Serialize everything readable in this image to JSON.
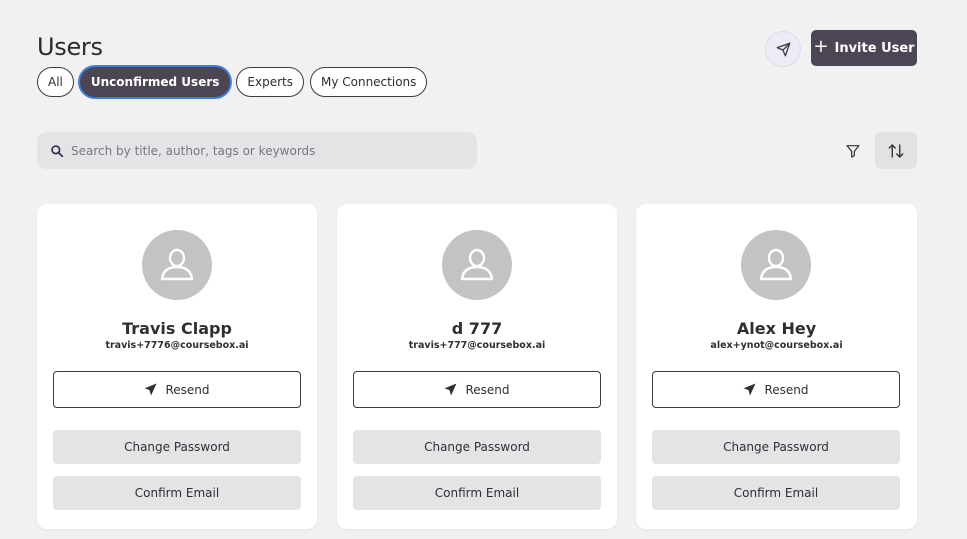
{
  "header": {
    "title": "Users",
    "invite_label": "Invite User",
    "invite_plus": "+"
  },
  "tabs": [
    {
      "label": "All",
      "active": false
    },
    {
      "label": "Unconfirmed Users",
      "active": true
    },
    {
      "label": "Experts",
      "active": false
    },
    {
      "label": "My Connections",
      "active": false
    }
  ],
  "search": {
    "placeholder": "Search by title, author, tags or keywords",
    "value": ""
  },
  "cards": [
    {
      "name": "Travis Clapp",
      "email": "travis+7776@coursebox.ai",
      "resend_label": "Resend",
      "change_password_label": "Change Password",
      "confirm_email_label": "Confirm Email"
    },
    {
      "name": "d 777",
      "email": "travis+777@coursebox.ai",
      "resend_label": "Resend",
      "change_password_label": "Change Password",
      "confirm_email_label": "Confirm Email"
    },
    {
      "name": "Alex Hey",
      "email": "alex+ynot@coursebox.ai",
      "resend_label": "Resend",
      "change_password_label": "Change Password",
      "confirm_email_label": "Confirm Email"
    }
  ],
  "icons": {
    "send": "send-icon",
    "search": "search-icon",
    "filter": "filter-icon",
    "sort": "sort-icon",
    "avatar": "user-icon"
  },
  "colors": {
    "accent": "#4c4654",
    "active_ring": "#3f7fe0",
    "background": "#f1f1f1",
    "avatar": "#c3c3c3"
  }
}
